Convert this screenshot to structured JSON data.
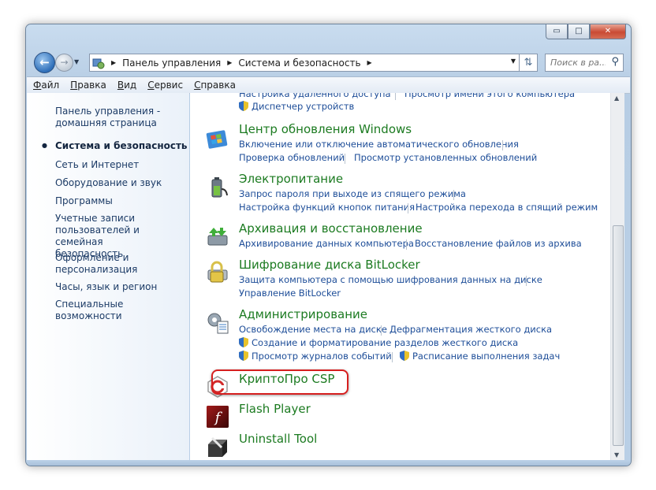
{
  "window": {
    "caption_buttons": {
      "minimize": "▭",
      "maximize": "□",
      "close": "✕"
    }
  },
  "navigation": {
    "back_icon": "arrow-left-icon",
    "forward_icon": "arrow-right-icon",
    "breadcrumbs": [
      "Панель управления",
      "Система и безопасность"
    ],
    "search_placeholder": "Поиск в ра..."
  },
  "menu": [
    "Файл",
    "Правка",
    "Вид",
    "Сервис",
    "Справка"
  ],
  "sidebar": {
    "home_line1": "Панель управления -",
    "home_line2": "домашняя страница",
    "items": [
      "Система и безопасность",
      "Сеть и Интернет",
      "Оборудование и звук",
      "Программы",
      "Учетные записи",
      "пользователей и семейная",
      "безопасность",
      "Оформление и",
      "персонализация",
      "Часы, язык и регион",
      "Специальные возможности"
    ]
  },
  "content": {
    "top_cut_left": "Настройка удаленного доступа",
    "top_cut_right": "Просмотр имени этого компьютера",
    "device_manager": "Диспетчер устройств",
    "categories": [
      {
        "title": "Центр обновления Windows",
        "links": [
          "Включение или отключение автоматического обновления",
          "Проверка обновлений",
          "Просмотр установленных обновлений"
        ]
      },
      {
        "title": "Электропитание",
        "links": [
          "Запрос пароля при выходе из спящего режима",
          "Настройка функций кнопок питания",
          "Настройка перехода в спящий режим"
        ]
      },
      {
        "title": "Архивация и восстановление",
        "links": [
          "Архивирование данных компьютера",
          "Восстановление файлов из архива"
        ]
      },
      {
        "title": "Шифрование диска BitLocker",
        "links": [
          "Защита компьютера с помощью шифрования данных на диске",
          "Управление BitLocker"
        ]
      },
      {
        "title": "Администрирование",
        "links": [
          "Освобождение места на диске",
          "Дефрагментация жесткого диска",
          "Создание и форматирование разделов жесткого диска",
          "Просмотр журналов событий",
          "Расписание выполнения задач"
        ]
      },
      {
        "title": "КриптоПро CSP",
        "links": []
      },
      {
        "title": "Flash Player",
        "links": []
      },
      {
        "title": "Uninstall Tool",
        "links": []
      }
    ]
  },
  "colors": {
    "category_title": "#1c7b21",
    "link": "#1d4d98",
    "highlight": "#d61f1f"
  }
}
